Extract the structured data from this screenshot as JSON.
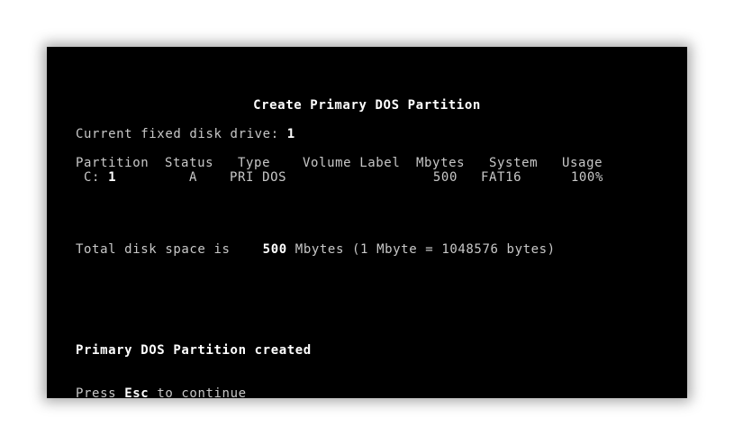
{
  "screen": {
    "title": "Create Primary DOS Partition",
    "current_drive_label": "Current fixed disk drive:",
    "current_drive_value": "1",
    "table": {
      "headers": {
        "partition": "Partition",
        "status": "Status",
        "type": "Type",
        "volume_label": "Volume Label",
        "mbytes": "Mbytes",
        "system": "System",
        "usage": "Usage"
      },
      "rows": [
        {
          "partition_drive": "C:",
          "partition_num": "1",
          "status": "A",
          "type": "PRI DOS",
          "volume_label": "",
          "mbytes": "500",
          "system": "FAT16",
          "usage": "100%"
        }
      ]
    },
    "total_label": "Total disk space is",
    "total_value": "500",
    "total_suffix": "Mbytes (1 Mbyte = 1048576 bytes)",
    "message": "Primary DOS Partition created",
    "prompt_prefix": "Press",
    "prompt_key": "Esc",
    "prompt_suffix": "to continue"
  },
  "colors": {
    "background": "#000000",
    "text": "#c8c8c8",
    "highlight": "#ffffff"
  }
}
